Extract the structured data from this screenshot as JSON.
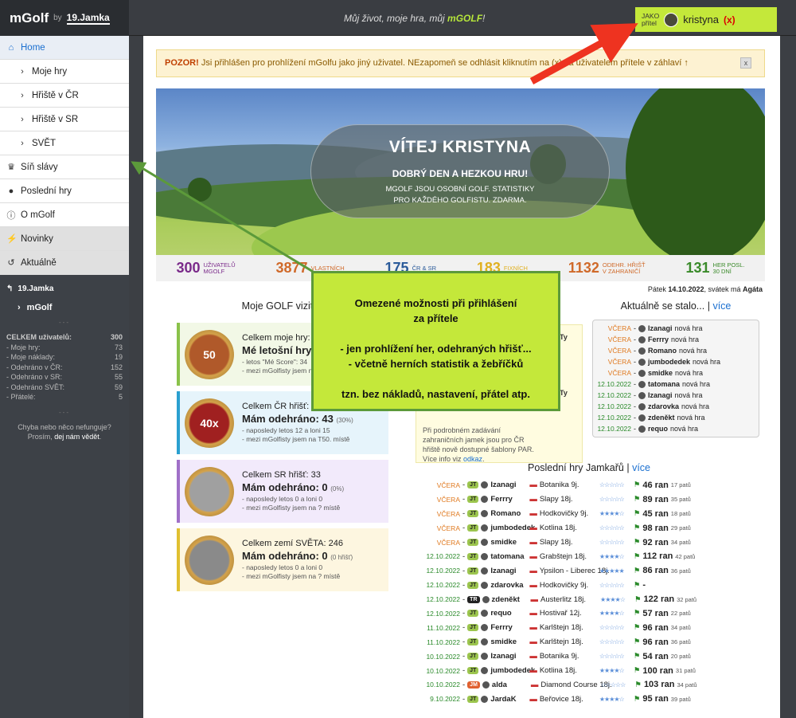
{
  "brand": {
    "logo": "mGolf",
    "by": "by",
    "partner": "19.Jamka"
  },
  "slogan_pre": "Můj život, moje hra, můj ",
  "slogan_brand": "mGOLF",
  "slogan_post": "!",
  "user": {
    "jako_line1": "JAKO",
    "jako_line2": "přítel",
    "name": "kristyna",
    "exit": "(x)"
  },
  "nav": [
    {
      "label": "Home",
      "icon": "home-icon"
    },
    {
      "label": "Moje hry"
    },
    {
      "label": "Hřiště v ČR"
    },
    {
      "label": "Hřiště v SR"
    },
    {
      "label": "SVĚT"
    },
    {
      "label": "Síň slávy",
      "icon": "trophy-icon"
    },
    {
      "label": "Poslední hry",
      "icon": "pin-icon"
    },
    {
      "label": "O mGolf",
      "icon": "info-icon"
    },
    {
      "label": "Novinky",
      "icon": "bolt-icon"
    },
    {
      "label": "Aktuálně",
      "icon": "history-icon"
    }
  ],
  "side": {
    "partner": "19.Jamka",
    "mgolf": "mGolf",
    "sep": "---",
    "stats_title": "CELKEM uživatelů:",
    "stats_title_val": "300",
    "stats": [
      {
        "l": "- Moje hry:",
        "v": "73"
      },
      {
        "l": "- Moje náklady:",
        "v": "19"
      },
      {
        "l": "- Odehráno v ČR:",
        "v": "152"
      },
      {
        "l": "- Odehráno v SR:",
        "v": "55"
      },
      {
        "l": "- Odehráno SVĚT:",
        "v": "59"
      },
      {
        "l": "- Přátelé:",
        "v": "5"
      }
    ],
    "err_line1": "Chyba nebo něco nefunguje?",
    "err_line2a": "Prosím, ",
    "err_link": "dej nám vědět",
    "err_line2b": "."
  },
  "warning": {
    "strong": "POZOR!",
    "text": " Jsi přihlášen pro prohlížení mGolfu jako jiný uživatel. NEzapomeň se odhlásit kliknutím na (x) za uživatelem přítele v záhlaví ↑",
    "close": "x"
  },
  "hero": {
    "title": "VÍTEJ KRISTYNA",
    "subtitle": "DOBRÝ DEN A HEZKOU HRU!",
    "line1": "MGOLF JSOU OSOBNÍ GOLF. STATISTIKY",
    "line2": "PRO KAŽDÉHO GOLFISTU. ZDARMA."
  },
  "stats_bar": [
    {
      "n": "300",
      "l1": "UŽIVATELŮ",
      "l2": "MGOLF",
      "color": "#7a2a8a"
    },
    {
      "n": "3877",
      "l1": "VLASTNÍCH",
      "l2": "",
      "color": "#d06a2a"
    },
    {
      "n": "175",
      "l1": "ČR & SR",
      "l2": "",
      "color": "#2a5a9a"
    },
    {
      "n": "183",
      "l1": "FIXNÍCH",
      "l2": "",
      "color": "#e0b020"
    },
    {
      "n": "1132",
      "l1": "ODEHR. HŘIŠŤ",
      "l2": "V ZAHRANIČÍ",
      "color": "#d06a2a"
    },
    {
      "n": "131",
      "l1": "HER POSL.",
      "l2": "30 DNÍ",
      "color": "#3a8a2a"
    }
  ],
  "date_pre": "Pátek ",
  "date": "14.10.2022",
  "date_mid": ", svátek má ",
  "date_name": "Agáta",
  "left_heading": "Moje GOLF vizitka",
  "cards": [
    {
      "l1": "Celkem moje hry: 73",
      "l2": "Mé letošní hry: 50",
      "l3a": "- letos \"Mé Score\": 34",
      "l3b": "- mezi mGolfisty jsem na 7. místě",
      "coin": "50",
      "border": "#8ac24a",
      "bg": "#f2f8e6",
      "coin_bg": "#b0592a"
    },
    {
      "l1": "Celkem ČR hřišť: 152",
      "l2": "Mám odehráno: 43",
      "l2s": "(30%)",
      "l3a": "- naposledy letos 12 a loni 15",
      "l3b": "- mezi mGolfisty jsem na T50. místě",
      "coin": "40x",
      "border": "#2aa0d0",
      "bg": "#e6f4fb",
      "coin_bg": "#a02020"
    },
    {
      "l1": "Celkem SR hřišť: 33",
      "l2": "Mám odehráno: 0",
      "l2s": "(0%)",
      "l3a": "- naposledy letos 0 a loni 0",
      "l3b": "- mezi mGolfisty jsem na ? místě",
      "coin": "",
      "border": "#a070c8",
      "bg": "#f2eafb",
      "coin_bg": "#a0a0a0"
    },
    {
      "l1": "Celkem zemí SVĚTA: 246",
      "l2": "Mám odehráno: 0",
      "l2s": "(0 hřišť)",
      "l3a": "- naposledy letos 0 a loni 0",
      "l3b": "- mezi mGolfisty jsem na ? místě",
      "coin": "",
      "border": "#e0c030",
      "bg": "#fdf6e0",
      "coin_bg": "#8a8a8a"
    }
  ],
  "mid": {
    "hl1": "Ty",
    "hl2": "Ty",
    "note_line1": "Při podrobném zadávání",
    "note_line2": "zahraničních jamek jsou pro ČR",
    "note_line3": "hřiště nově dostupné šablony PAR.",
    "note_line4": "Více info viz ",
    "note_link": "odkaz",
    "note_end": "."
  },
  "right_heading": "Aktuálně se stalo...",
  "right_more": "více",
  "activity": [
    {
      "d": "VČERA",
      "n": "Izanagi",
      "t": "nová hra"
    },
    {
      "d": "VČERA",
      "n": "Ferrry",
      "t": "nová hra"
    },
    {
      "d": "VČERA",
      "n": "Romano",
      "t": "nová hra"
    },
    {
      "d": "VČERA",
      "n": "jumbodedek",
      "t": "nová hra"
    },
    {
      "d": "VČERA",
      "n": "smidke",
      "t": "nová hra"
    },
    {
      "d": "12.10.2022",
      "n": "tatomana",
      "t": "nová hra"
    },
    {
      "d": "12.10.2022",
      "n": "Izanagi",
      "t": "nová hra"
    },
    {
      "d": "12.10.2022",
      "n": "zdarovka",
      "t": "nová hra"
    },
    {
      "d": "12.10.2022",
      "n": "zdeněkt",
      "t": "nová hra"
    },
    {
      "d": "12.10.2022",
      "n": "requo",
      "t": "nová hra"
    }
  ],
  "games_heading": "Poslední hry Jamkařů",
  "games_more": "více",
  "games": [
    {
      "d": "VČERA",
      "tag": "JT",
      "n": "Izanagi",
      "c": "Botanika 9j.",
      "s": "☆☆☆☆☆",
      "r": "46 ran",
      "p": "17 patů"
    },
    {
      "d": "VČERA",
      "tag": "JT",
      "n": "Ferrry",
      "c": "Slapy 18j.",
      "s": "☆☆☆☆☆",
      "r": "89 ran",
      "p": "35 patů"
    },
    {
      "d": "VČERA",
      "tag": "JT",
      "n": "Romano",
      "c": "Hodkovičky 9j.",
      "s": "★★★★☆",
      "r": "45 ran",
      "p": "18 patů"
    },
    {
      "d": "VČERA",
      "tag": "JT",
      "n": "jumbodedek",
      "c": "Kotlina 18j.",
      "s": "☆☆☆☆☆",
      "r": "98 ran",
      "p": "29 patů"
    },
    {
      "d": "VČERA",
      "tag": "JT",
      "n": "smidke",
      "c": "Slapy 18j.",
      "s": "☆☆☆☆☆",
      "r": "92 ran",
      "p": "34 patů"
    },
    {
      "d": "12.10.2022",
      "tag": "JT",
      "n": "tatomana",
      "c": "Grabštejn 18j.",
      "s": "★★★★☆",
      "r": "112 ran",
      "p": "42 patů"
    },
    {
      "d": "12.10.2022",
      "tag": "JT",
      "n": "Izanagi",
      "c": "Ypsilon - Liberec 18j.",
      "s": "★★★★★",
      "r": "86 ran",
      "p": "36 patů"
    },
    {
      "d": "12.10.2022",
      "tag": "JT",
      "n": "zdarovka",
      "c": "Hodkovičky 9j.",
      "s": "☆☆☆☆☆",
      "r": "-",
      "p": ""
    },
    {
      "d": "12.10.2022",
      "tag": "TR",
      "n": "zdeněkt",
      "c": "Austerlitz 18j.",
      "s": "★★★★☆",
      "r": "122 ran",
      "p": "32 patů"
    },
    {
      "d": "12.10.2022",
      "tag": "JT",
      "n": "requo",
      "c": "Hostivař 12j.",
      "s": "★★★★☆",
      "r": "57 ran",
      "p": "22 patů"
    },
    {
      "d": "11.10.2022",
      "tag": "JT",
      "n": "Ferrry",
      "c": "Karlštejn 18j.",
      "s": "☆☆☆☆☆",
      "r": "96 ran",
      "p": "34 patů"
    },
    {
      "d": "11.10.2022",
      "tag": "JT",
      "n": "smidke",
      "c": "Karlštejn 18j.",
      "s": "☆☆☆☆☆",
      "r": "96 ran",
      "p": "36 patů"
    },
    {
      "d": "10.10.2022",
      "tag": "JT",
      "n": "Izanagi",
      "c": "Botanika 9j.",
      "s": "☆☆☆☆☆",
      "r": "54 ran",
      "p": "20 patů"
    },
    {
      "d": "10.10.2022",
      "tag": "JT",
      "n": "jumbodedek",
      "c": "Kotlina 18j.",
      "s": "★★★★☆",
      "r": "100 ran",
      "p": "31 patů"
    },
    {
      "d": "10.10.2022",
      "tag": "JM",
      "n": "alda",
      "c": "Diamond Course 18j.",
      "s": "☆☆☆☆☆",
      "r": "103 ran",
      "p": "34 patů"
    },
    {
      "d": "9.10.2022",
      "tag": "JT",
      "n": "JardaK",
      "c": "Beřovice 18j.",
      "s": "★★★★☆",
      "r": "95 ran",
      "p": "39 patů"
    }
  ],
  "callout": {
    "l1": "Omezené možnosti při přihlášení",
    "l2": "za přítele",
    "l3": "- jen prohlížení her, odehraných hřišť...",
    "l4": "- včetně herních statistik a žebříčků",
    "l5": "tzn. bez nákladů, nastavení, přátel atp."
  }
}
